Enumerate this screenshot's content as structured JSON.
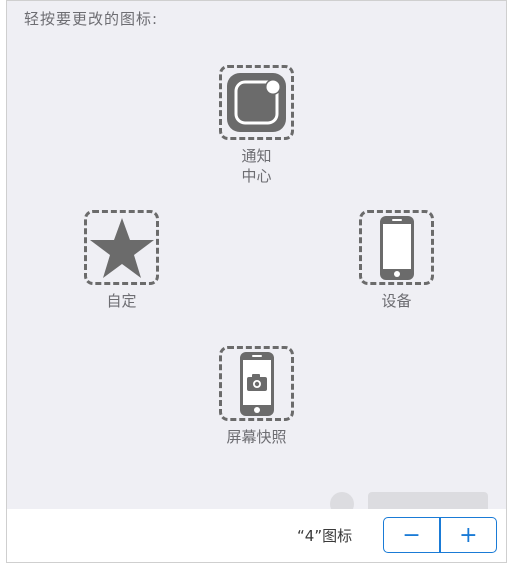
{
  "instruction": "轻按要更改的图标:",
  "slots": {
    "notification_center": {
      "label": "通知中心",
      "icon": "notification-center-icon"
    },
    "custom": {
      "label": "自定",
      "icon": "star-icon"
    },
    "device": {
      "label": "设备",
      "icon": "iphone-icon"
    },
    "screenshot": {
      "label": "屏幕快照",
      "icon": "camera-phone-icon"
    }
  },
  "footer": {
    "icon_count_text": "“4”图标",
    "decrease_label": "−",
    "increase_label": "+"
  },
  "colors": {
    "panel_bg": "#efeff4",
    "icon_fill": "#6b6b6b",
    "accent": "#1a7bd6"
  }
}
